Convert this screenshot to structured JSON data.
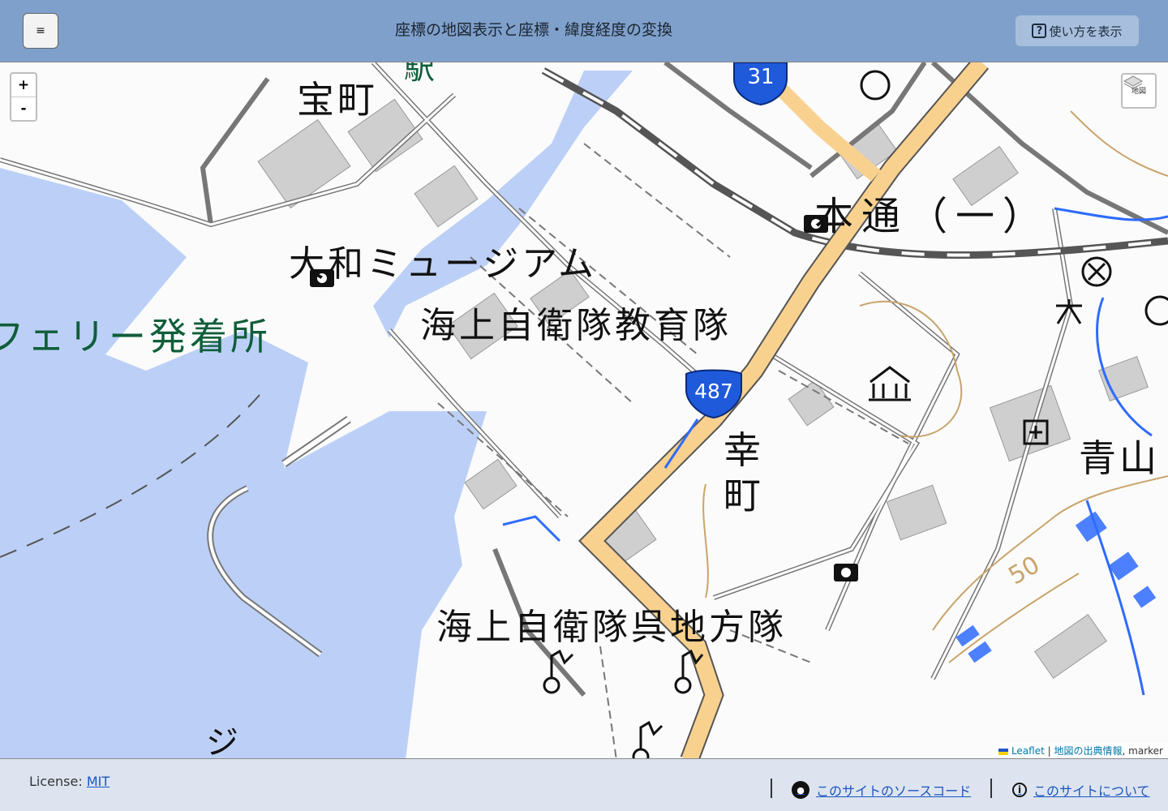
{
  "header": {
    "menu_icon": "hamburger-icon",
    "menu_glyph": "≡",
    "title": "座標の地図表示と座標・緯度経度の変換",
    "help_label": "使い方を表示",
    "help_glyph": "?"
  },
  "map": {
    "zoom_in": "+",
    "zoom_out": "-",
    "layers_label": "地図",
    "labels": {
      "takaramachi": "宝町",
      "yamato_museum": "大和ミュージアム",
      "ferry": "フェリー発着所",
      "jmsdf_school": "海上自衛隊教育隊",
      "hondori": "本通（一）",
      "saiwaicho": "幸町",
      "aoyama": "青山",
      "jmsdf_kure": "海上自衛隊呉地方隊",
      "station_partial": "駅",
      "ji": "ジ",
      "contour_50": "50"
    },
    "route_shields": [
      "31",
      "487"
    ],
    "colors": {
      "sea": "#bcd0f7",
      "road_major": "#f9d18f",
      "road_outline": "#595959",
      "river": "#2e6bff",
      "building": "#cfcfcf",
      "contour": "#c9a46a",
      "label_green": "#0f5e3a"
    },
    "attribution": {
      "leaflet": "Leaflet",
      "separator": "|",
      "source": "地図の出典情報",
      "marker": "marker"
    }
  },
  "footer": {
    "license_prefix": "License:",
    "license_link": "MIT",
    "source_link": "このサイトのソースコード",
    "about_link": "このサイトについて",
    "github_icon": "github-icon",
    "info_icon": "info-icon"
  }
}
